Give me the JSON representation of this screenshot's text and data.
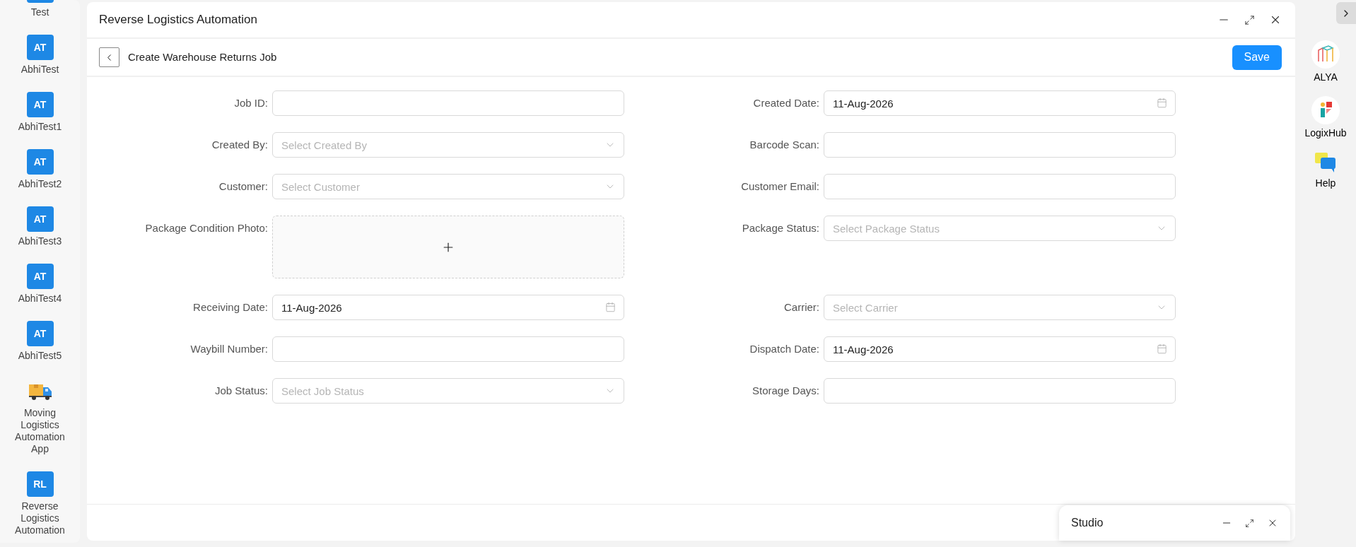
{
  "sidebar": {
    "items": [
      {
        "kind": "clipped",
        "label": "Test"
      },
      {
        "kind": "initials",
        "initials": "AT",
        "label": "AbhiTest"
      },
      {
        "kind": "initials",
        "initials": "AT",
        "label": "AbhiTest1"
      },
      {
        "kind": "initials",
        "initials": "AT",
        "label": "AbhiTest2"
      },
      {
        "kind": "initials",
        "initials": "AT",
        "label": "AbhiTest3"
      },
      {
        "kind": "initials",
        "initials": "AT",
        "label": "AbhiTest4"
      },
      {
        "kind": "initials",
        "initials": "AT",
        "label": "AbhiTest5"
      },
      {
        "kind": "truck",
        "label": "Moving Logistics Automation App"
      },
      {
        "kind": "initials",
        "initials": "RL",
        "label": "Reverse Logistics Automation"
      }
    ]
  },
  "window": {
    "title": "Reverse Logistics Automation"
  },
  "page": {
    "title": "Create Warehouse Returns Job",
    "save_button": "Save"
  },
  "form": {
    "fields": [
      {
        "kind": "text",
        "label": "Job ID:"
      },
      {
        "kind": "date",
        "label": "Created Date:",
        "value": "11-Aug-2026"
      },
      {
        "kind": "select",
        "label": "Created By:",
        "placeholder": "Select Created By"
      },
      {
        "kind": "text",
        "label": "Barcode Scan:"
      },
      {
        "kind": "select",
        "label": "Customer:",
        "placeholder": "Select Customer"
      },
      {
        "kind": "text",
        "label": "Customer Email:"
      },
      {
        "kind": "upload",
        "label": "Package Condition Photo:"
      },
      {
        "kind": "select",
        "label": "Package Status:",
        "placeholder": "Select Package Status"
      },
      {
        "kind": "date",
        "label": "Receiving Date:",
        "value": "11-Aug-2026"
      },
      {
        "kind": "select",
        "label": "Carrier:",
        "placeholder": "Select Carrier"
      },
      {
        "kind": "text",
        "label": "Waybill Number:"
      },
      {
        "kind": "date",
        "label": "Dispatch Date:",
        "value": "11-Aug-2026"
      },
      {
        "kind": "select",
        "label": "Job Status:",
        "placeholder": "Select Job Status"
      },
      {
        "kind": "text",
        "label": "Storage Days:"
      }
    ]
  },
  "right_rail": {
    "items": [
      {
        "kind": "alya",
        "label": "ALYA"
      },
      {
        "kind": "logixhub",
        "label": "LogixHub"
      },
      {
        "kind": "help",
        "label": "Help"
      }
    ]
  },
  "studio": {
    "title": "Studio"
  }
}
